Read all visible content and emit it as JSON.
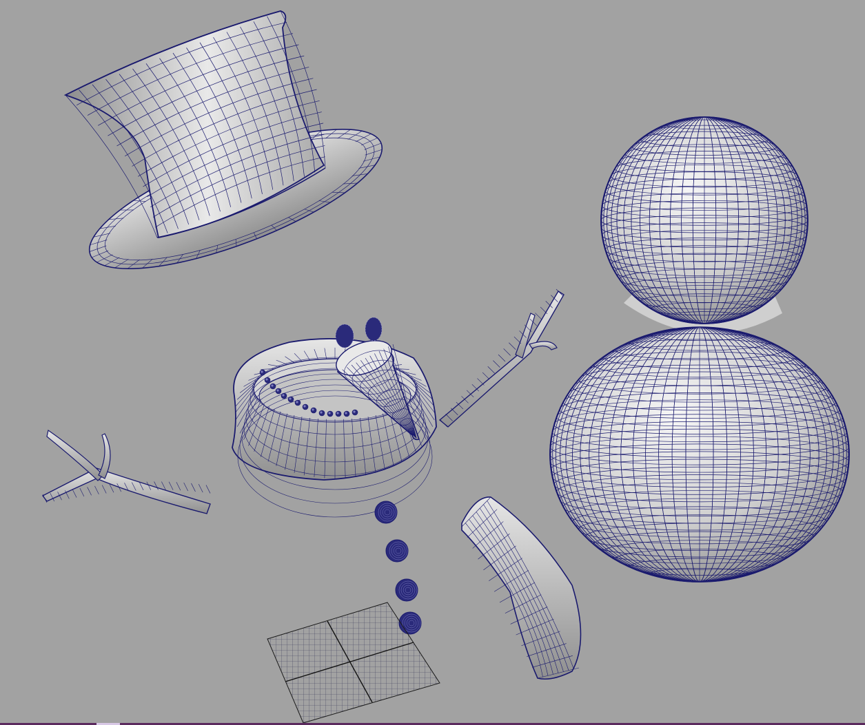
{
  "viewport": {
    "label": "",
    "background_color": "#a2a2a2",
    "wireframe_color": "#1a1a6e",
    "surface_light": "#f0f0f0",
    "surface_dark": "#8e8e8e",
    "status_strip_color": "#5b2a5e"
  },
  "scene_objects": [
    {
      "name": "top-hat",
      "icon": "cylinder-mesh"
    },
    {
      "name": "snowman-body",
      "icon": "sphere-mesh"
    },
    {
      "name": "scarf-ring",
      "icon": "torus-mesh"
    },
    {
      "name": "carrot-nose",
      "icon": "cone-mesh"
    },
    {
      "name": "eye-left",
      "icon": "sphere-mesh"
    },
    {
      "name": "eye-right",
      "icon": "sphere-mesh"
    },
    {
      "name": "mouth-beads",
      "icon": "sphere-mesh"
    },
    {
      "name": "arm-right",
      "icon": "branch-mesh"
    },
    {
      "name": "arm-left",
      "icon": "branch-mesh"
    },
    {
      "name": "buttons",
      "icon": "sphere-mesh"
    },
    {
      "name": "scarf-tail",
      "icon": "curved-plane-mesh"
    },
    {
      "name": "ground-grid-plane",
      "icon": "grid-mesh"
    }
  ]
}
